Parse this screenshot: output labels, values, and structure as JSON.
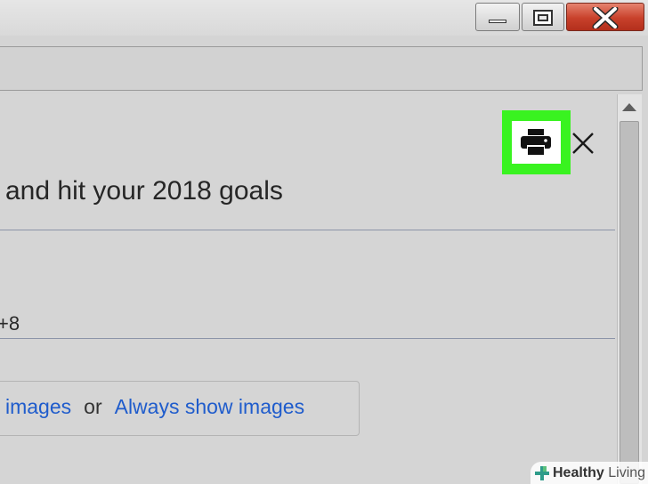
{
  "window": {
    "minimize_icon": "minimize-icon",
    "maximize_icon": "maximize-icon",
    "close_icon": "close-icon"
  },
  "email": {
    "subject_fragment": "and hit your 2018 goals",
    "sender_fragment": "+8",
    "print_icon": "printer-icon",
    "close_icon": "close-x-icon",
    "highlight_color": "#39f320"
  },
  "images_bar": {
    "show_images_link": "images",
    "separator": "or",
    "always_show_link": "Always show images"
  },
  "watermark": {
    "brand_bold": "Healthy",
    "brand_light": " Living",
    "logo_icon": "plus-leaf-icon"
  },
  "colors": {
    "link": "#1f5ccc",
    "close_button": "#c8412b"
  }
}
